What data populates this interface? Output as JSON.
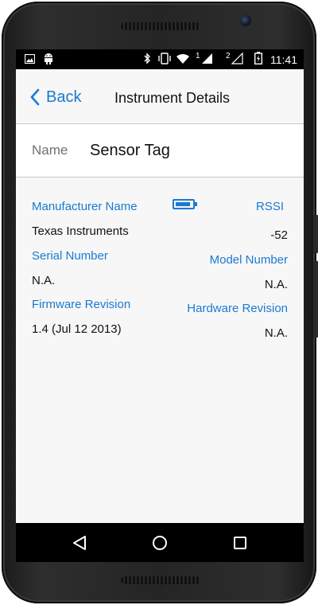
{
  "status_bar": {
    "time": "11:41",
    "sim1_label": "1",
    "sim2_label": "2",
    "icons": [
      "image-icon",
      "android-icon",
      "bluetooth-icon",
      "vibrate-icon",
      "wifi-icon",
      "signal-icon",
      "battery-charging-icon"
    ]
  },
  "header": {
    "back_label": "Back",
    "title": "Instrument Details"
  },
  "name_row": {
    "label": "Name",
    "value": "Sensor Tag"
  },
  "details": {
    "manufacturer_label": "Manufacturer Name",
    "manufacturer_value": "Texas Instruments",
    "rssi_label": "RSSI",
    "rssi_value": "-52",
    "serial_label": "Serial Number",
    "serial_value": "N.A.",
    "model_label": "Model Number",
    "model_value": "N.A.",
    "firmware_label": "Firmware Revision",
    "firmware_value": "1.4 (Jul 12 2013)",
    "hardware_label": "Hardware Revision",
    "hardware_value": "N.A."
  },
  "battery_level": 0.9,
  "accent_color": "#1a7ad3",
  "nav_bar": {
    "buttons": [
      "back-triangle-icon",
      "home-circle-icon",
      "recents-square-icon"
    ]
  }
}
